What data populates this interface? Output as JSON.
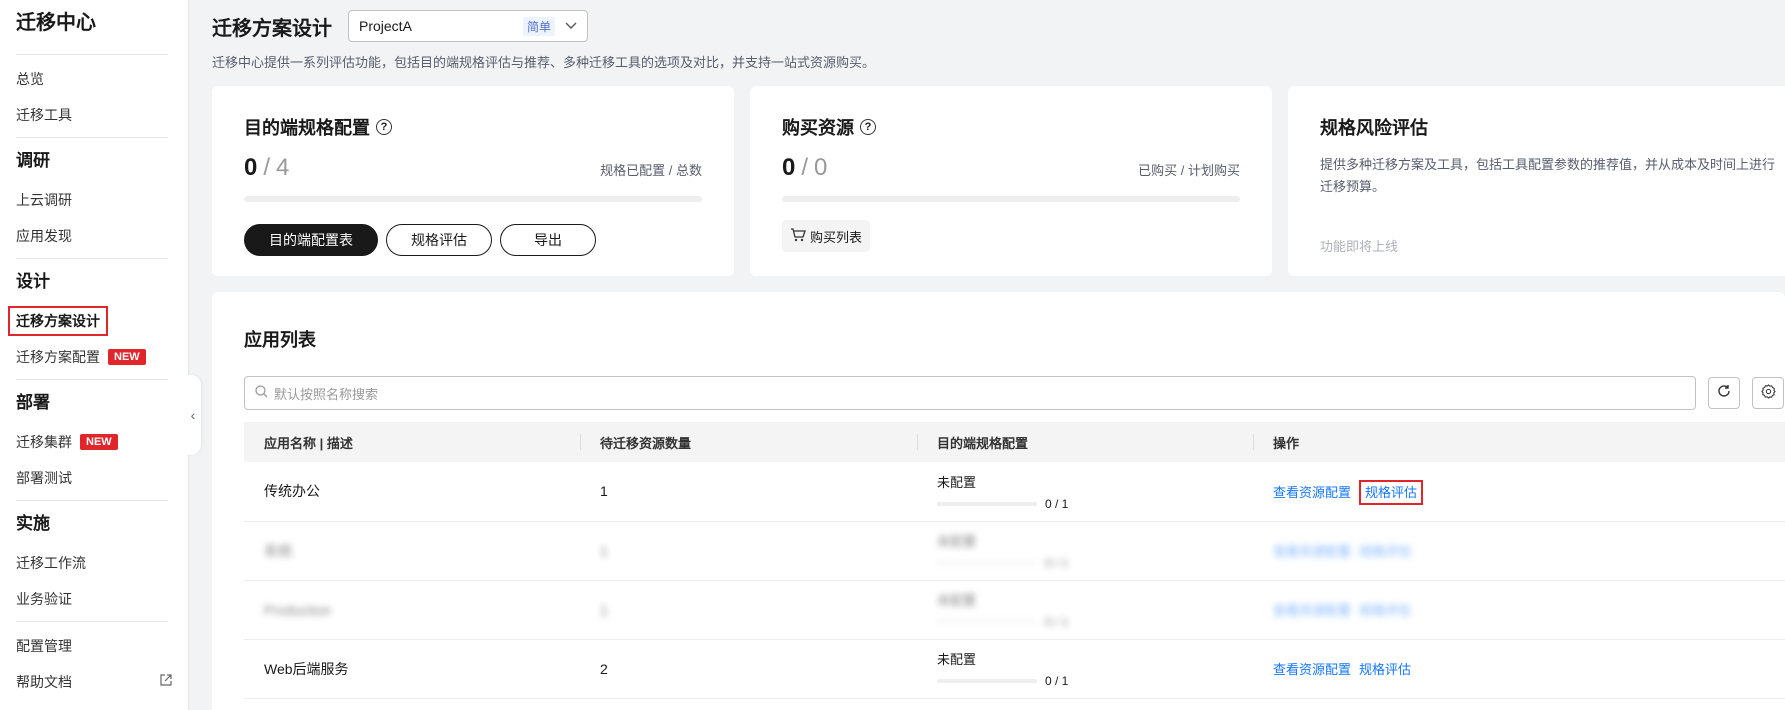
{
  "sidebar": {
    "title": "迁移中心",
    "top_items": [
      "总览",
      "迁移工具"
    ],
    "sections": [
      {
        "title": "调研",
        "items": [
          {
            "label": "上云调研"
          },
          {
            "label": "应用发现"
          }
        ]
      },
      {
        "title": "设计",
        "items": [
          {
            "label": "迁移方案设计",
            "active": true
          },
          {
            "label": "迁移方案配置",
            "badge": "NEW"
          }
        ]
      },
      {
        "title": "部署",
        "items": [
          {
            "label": "迁移集群",
            "badge": "NEW"
          },
          {
            "label": "部署测试"
          }
        ]
      },
      {
        "title": "实施",
        "items": [
          {
            "label": "迁移工作流"
          },
          {
            "label": "业务验证"
          }
        ]
      }
    ],
    "bottom_items": [
      "配置管理",
      "帮助文档"
    ],
    "badge": "NEW"
  },
  "header": {
    "title": "迁移方案设计",
    "project": "ProjectA",
    "project_tag": "简单",
    "description": "迁移中心提供一系列评估功能，包括目的端规格评估与推荐、多种迁移工具的选项及对比，并支持一站式资源购买。"
  },
  "cards": {
    "spec": {
      "title": "目的端规格配置",
      "configured": "0",
      "total": "4",
      "progress": 0,
      "caption": "规格已配置 / 总数",
      "buttons": {
        "table": "目的端配置表",
        "assess": "规格评估",
        "export": "导出"
      }
    },
    "purchase": {
      "title": "购买资源",
      "bought": "0",
      "planned": "0",
      "progress": 0,
      "caption": "已购买 / 计划购买",
      "cart_label": "购买列表"
    },
    "risk": {
      "title": "规格风险评估",
      "description": "提供多种迁移方案及工具，包括工具配置参数的推荐值，并从成本及时间上进行迁移预算。",
      "coming_soon": "功能即将上线"
    }
  },
  "app_list": {
    "title": "应用列表",
    "search_placeholder": "默认按照名称搜索",
    "columns": [
      "应用名称 | 描述",
      "待迁移资源数量",
      "目的端规格配置",
      "操作"
    ],
    "rows": [
      {
        "name": "传统办公",
        "count": "1",
        "cfg_label": "未配置",
        "cfg_count": "0 / 1",
        "progress": 0,
        "blurred": false,
        "highlight": true
      },
      {
        "name": "系统",
        "count": "1",
        "cfg_label": "未配置",
        "cfg_count": "0 / 1",
        "progress": 0,
        "blurred": true,
        "highlight": false
      },
      {
        "name": "Production",
        "count": "1",
        "cfg_label": "未配置",
        "cfg_count": "0 / 1",
        "progress": 0,
        "blurred": true,
        "highlight": false
      },
      {
        "name": "Web后端服务",
        "count": "2",
        "cfg_label": "未配置",
        "cfg_count": "0 / 1",
        "progress": 0,
        "blurred": false,
        "highlight": false
      }
    ],
    "ops": {
      "view": "查看资源配置",
      "assess": "规格评估"
    }
  }
}
